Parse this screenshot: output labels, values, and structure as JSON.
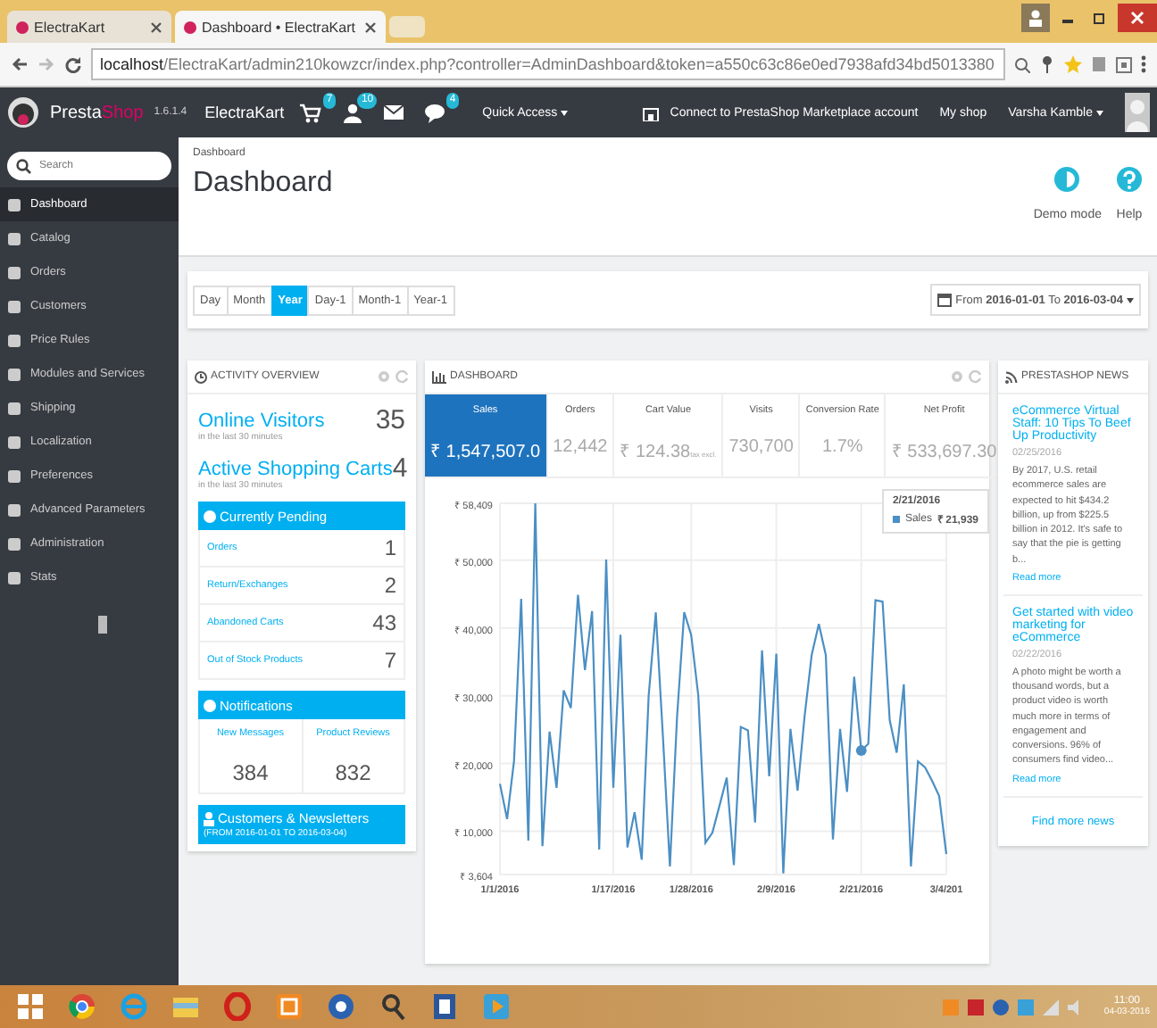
{
  "browser": {
    "tabs": [
      {
        "title": "ElectraKart",
        "selected": false
      },
      {
        "title": "Dashboard • ElectraKart",
        "selected": true
      }
    ],
    "url": {
      "host": "localhost",
      "path": "/ElectraKart/admin210kowzcr/index.php?controller=AdminDashboard&token=a550c63c86e0ed7938afd34bd5013380"
    }
  },
  "header": {
    "brand_main": "Presta",
    "brand_accent": "Shop",
    "version": "1.6.1.4",
    "shop": "ElectraKart",
    "notifications": [
      {
        "kind": "cart",
        "count": "7"
      },
      {
        "kind": "user",
        "count": "10"
      },
      {
        "kind": "mail"
      },
      {
        "kind": "chat",
        "count": "4"
      }
    ],
    "quick_access": "Quick Access",
    "marketplace": "Connect to PrestaShop Marketplace account",
    "my_shop": "My shop",
    "user": "Varsha Kamble"
  },
  "sidebar": {
    "search": {
      "placeholder": "Search"
    },
    "items": [
      {
        "label": "Dashboard",
        "selected": true
      },
      {
        "label": "Catalog",
        "selected": false
      },
      {
        "label": "Orders",
        "selected": false
      },
      {
        "label": "Customers",
        "selected": false
      },
      {
        "label": "Price Rules",
        "selected": false
      },
      {
        "label": "Modules and Services",
        "selected": false
      },
      {
        "label": "Shipping",
        "selected": false
      },
      {
        "label": "Localization",
        "selected": false
      },
      {
        "label": "Preferences",
        "selected": false
      },
      {
        "label": "Advanced Parameters",
        "selected": false
      },
      {
        "label": "Administration",
        "selected": false
      },
      {
        "label": "Stats",
        "selected": false
      }
    ]
  },
  "page": {
    "breadcrumb": "Dashboard",
    "title": "Dashboard",
    "demo_mode": "Demo mode",
    "help": "Help"
  },
  "periods": [
    {
      "label": "Day",
      "selected": false
    },
    {
      "label": "Month",
      "selected": false
    },
    {
      "label": "Year",
      "selected": true
    },
    {
      "label": "Day-1",
      "selected": false
    },
    {
      "label": "Month-1",
      "selected": false
    },
    {
      "label": "Year-1",
      "selected": false
    }
  ],
  "date_range": "From **2016-01-01** To **2016-03-04**",
  "activity": {
    "title": "ACTIVITY OVERVIEW",
    "stats": [
      {
        "label": "Online Visitors",
        "sub": "in the last 30 minutes",
        "value": "35"
      },
      {
        "label": "Active Shopping Carts",
        "sub": "in the last 30 minutes",
        "value": "4"
      }
    ],
    "pending_title": "Currently Pending",
    "pending": [
      {
        "label": "Orders",
        "value": "1"
      },
      {
        "label": "Return/Exchanges",
        "value": "2"
      },
      {
        "label": "Abandoned Carts",
        "value": "43"
      },
      {
        "label": "Out of Stock Products",
        "value": "7"
      }
    ],
    "notifications_title": "Notifications",
    "notifications": [
      {
        "label": "New Messages",
        "value": "384"
      },
      {
        "label": "Product Reviews",
        "value": "832"
      }
    ],
    "customers_title": "Customers & Newsletters",
    "customers_range": "(FROM 2016-01-01 TO 2016-03-04)"
  },
  "dashboard": {
    "title": "DASHBOARD",
    "kpis": [
      {
        "label": "Sales",
        "value": "₹ 1,547,507.0",
        "selected": true
      },
      {
        "label": "Orders",
        "value": "12,442",
        "selected": false
      },
      {
        "label": "Cart Value",
        "value": "₹ 124.38",
        "note": "tax excl.",
        "selected": false
      },
      {
        "label": "Visits",
        "value": "730,700",
        "selected": false
      },
      {
        "label": "Conversion Rate",
        "value": "1.7%",
        "selected": false
      },
      {
        "label": "Net Profit",
        "value": "₹ 533,697.30",
        "selected": false
      }
    ],
    "tooltip": {
      "date": "2/21/2016",
      "value": "₹ 21,939"
    },
    "chart_data": {
      "type": "line",
      "grid": true,
      "ylim": [
        3604,
        58409
      ],
      "categories": [
        "1/1/2016",
        null,
        null,
        null,
        null,
        null,
        null,
        null,
        null,
        null,
        null,
        null,
        null,
        null,
        null,
        null,
        "1/17/2016",
        null,
        null,
        null,
        null,
        null,
        null,
        null,
        null,
        null,
        null,
        "1/28/2016",
        null,
        null,
        null,
        null,
        null,
        null,
        null,
        null,
        null,
        null,
        null,
        "2/9/2016",
        null,
        null,
        null,
        null,
        null,
        null,
        null,
        null,
        null,
        null,
        null,
        "2/21/2016",
        null,
        null,
        null,
        null,
        null,
        null,
        null,
        null,
        null,
        null,
        null,
        "3/4/201"
      ],
      "yticks": [
        {
          "value": 3604,
          "label": "₹ 3,604"
        },
        {
          "value": 10000,
          "label": "₹ 10,000"
        },
        {
          "value": 20000,
          "label": "₹ 20,000"
        },
        {
          "value": 30000,
          "label": "₹ 30,000"
        },
        {
          "value": 40000,
          "label": "₹ 40,000"
        },
        {
          "value": 50000,
          "label": "₹ 50,000"
        },
        {
          "value": 58409,
          "label": "₹ 58,409"
        }
      ],
      "series": [
        {
          "name": "Sales",
          "color": "#4b8fc4",
          "values": [
            17000,
            11800,
            20400,
            44300,
            8600,
            58400,
            7800,
            24700,
            16400,
            30800,
            28200,
            44900,
            33800,
            42500,
            7300,
            50100,
            16400,
            39000,
            7600,
            12800,
            5800,
            30000,
            42300,
            23900,
            4800,
            26900,
            42300,
            39000,
            30000,
            8300,
            9800,
            13800,
            17900,
            5000,
            25400,
            24900,
            11300,
            36700,
            18100,
            36200,
            3800,
            25100,
            16000,
            26900,
            36000,
            40600,
            36000,
            8800,
            25100,
            15800,
            32800,
            21900,
            22900,
            44100,
            43900,
            26400,
            21600,
            31700,
            4800,
            20300,
            19400,
            17400,
            15200,
            6600
          ]
        }
      ]
    }
  },
  "news": {
    "title": "PRESTASHOP NEWS",
    "articles": [
      {
        "title": "eCommerce Virtual Staff: 10 Tips To Beef Up Productivity",
        "date": "02/25/2016",
        "text": "By 2017, U.S. retail ecommerce sales are expected to hit $434.2 billion, up from $225.5 billion in 2012. It's safe to say that the pie is getting b...",
        "link": "Read more"
      },
      {
        "title": "Get started with video marketing for eCommerce",
        "date": "02/22/2016",
        "text": "A photo might be worth a thousand words, but a product video is worth much more in terms of engagement and conversions. 96% of consumers find video...",
        "link": "Read more"
      }
    ],
    "more": "Find more news"
  },
  "taskbar": {
    "time": "11:00",
    "date": "04-03-2016"
  }
}
